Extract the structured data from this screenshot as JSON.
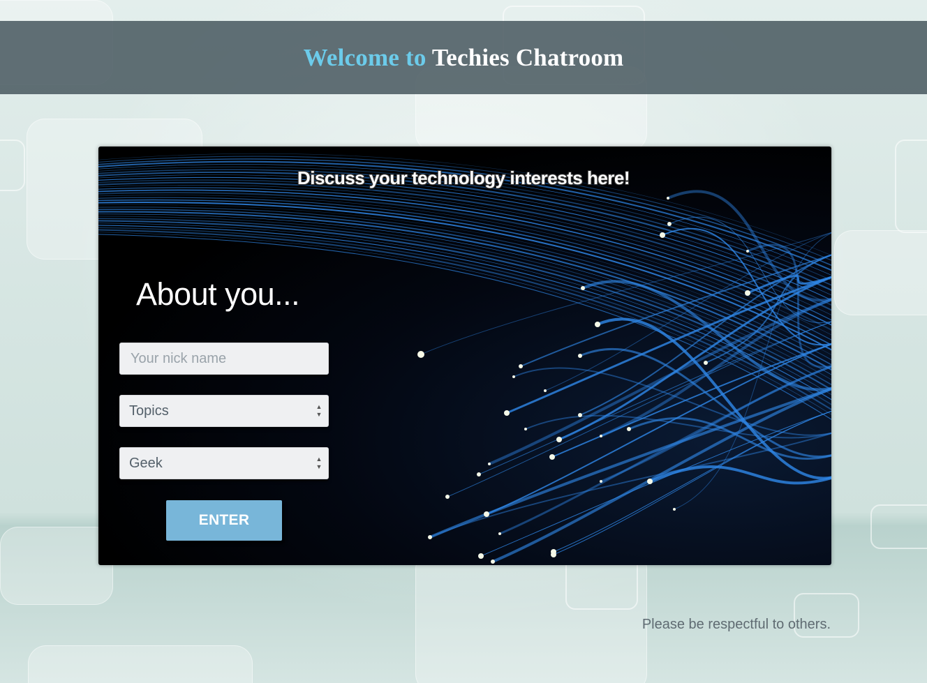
{
  "header": {
    "welcome": "Welcome to",
    "room_name": "Techies Chatroom",
    "colors": {
      "welcome": "#6ccbea",
      "room_name": "#ffffff",
      "bar": "#485860"
    }
  },
  "panel": {
    "tagline": "Discuss your technology interests here!",
    "about_title": "About you...",
    "nickname": {
      "placeholder": "Your nick name",
      "value": ""
    },
    "topics": {
      "selected": "Topics"
    },
    "level": {
      "selected": "Geek"
    },
    "enter_label": "ENTER",
    "colors": {
      "button": "#78b6d9",
      "fiber": "#2f86e6"
    }
  },
  "footer": {
    "note": "Please be respectful to others."
  },
  "icons": {
    "select_arrows": "select-arrows-icon",
    "background_art": "fiber-optics-image"
  }
}
